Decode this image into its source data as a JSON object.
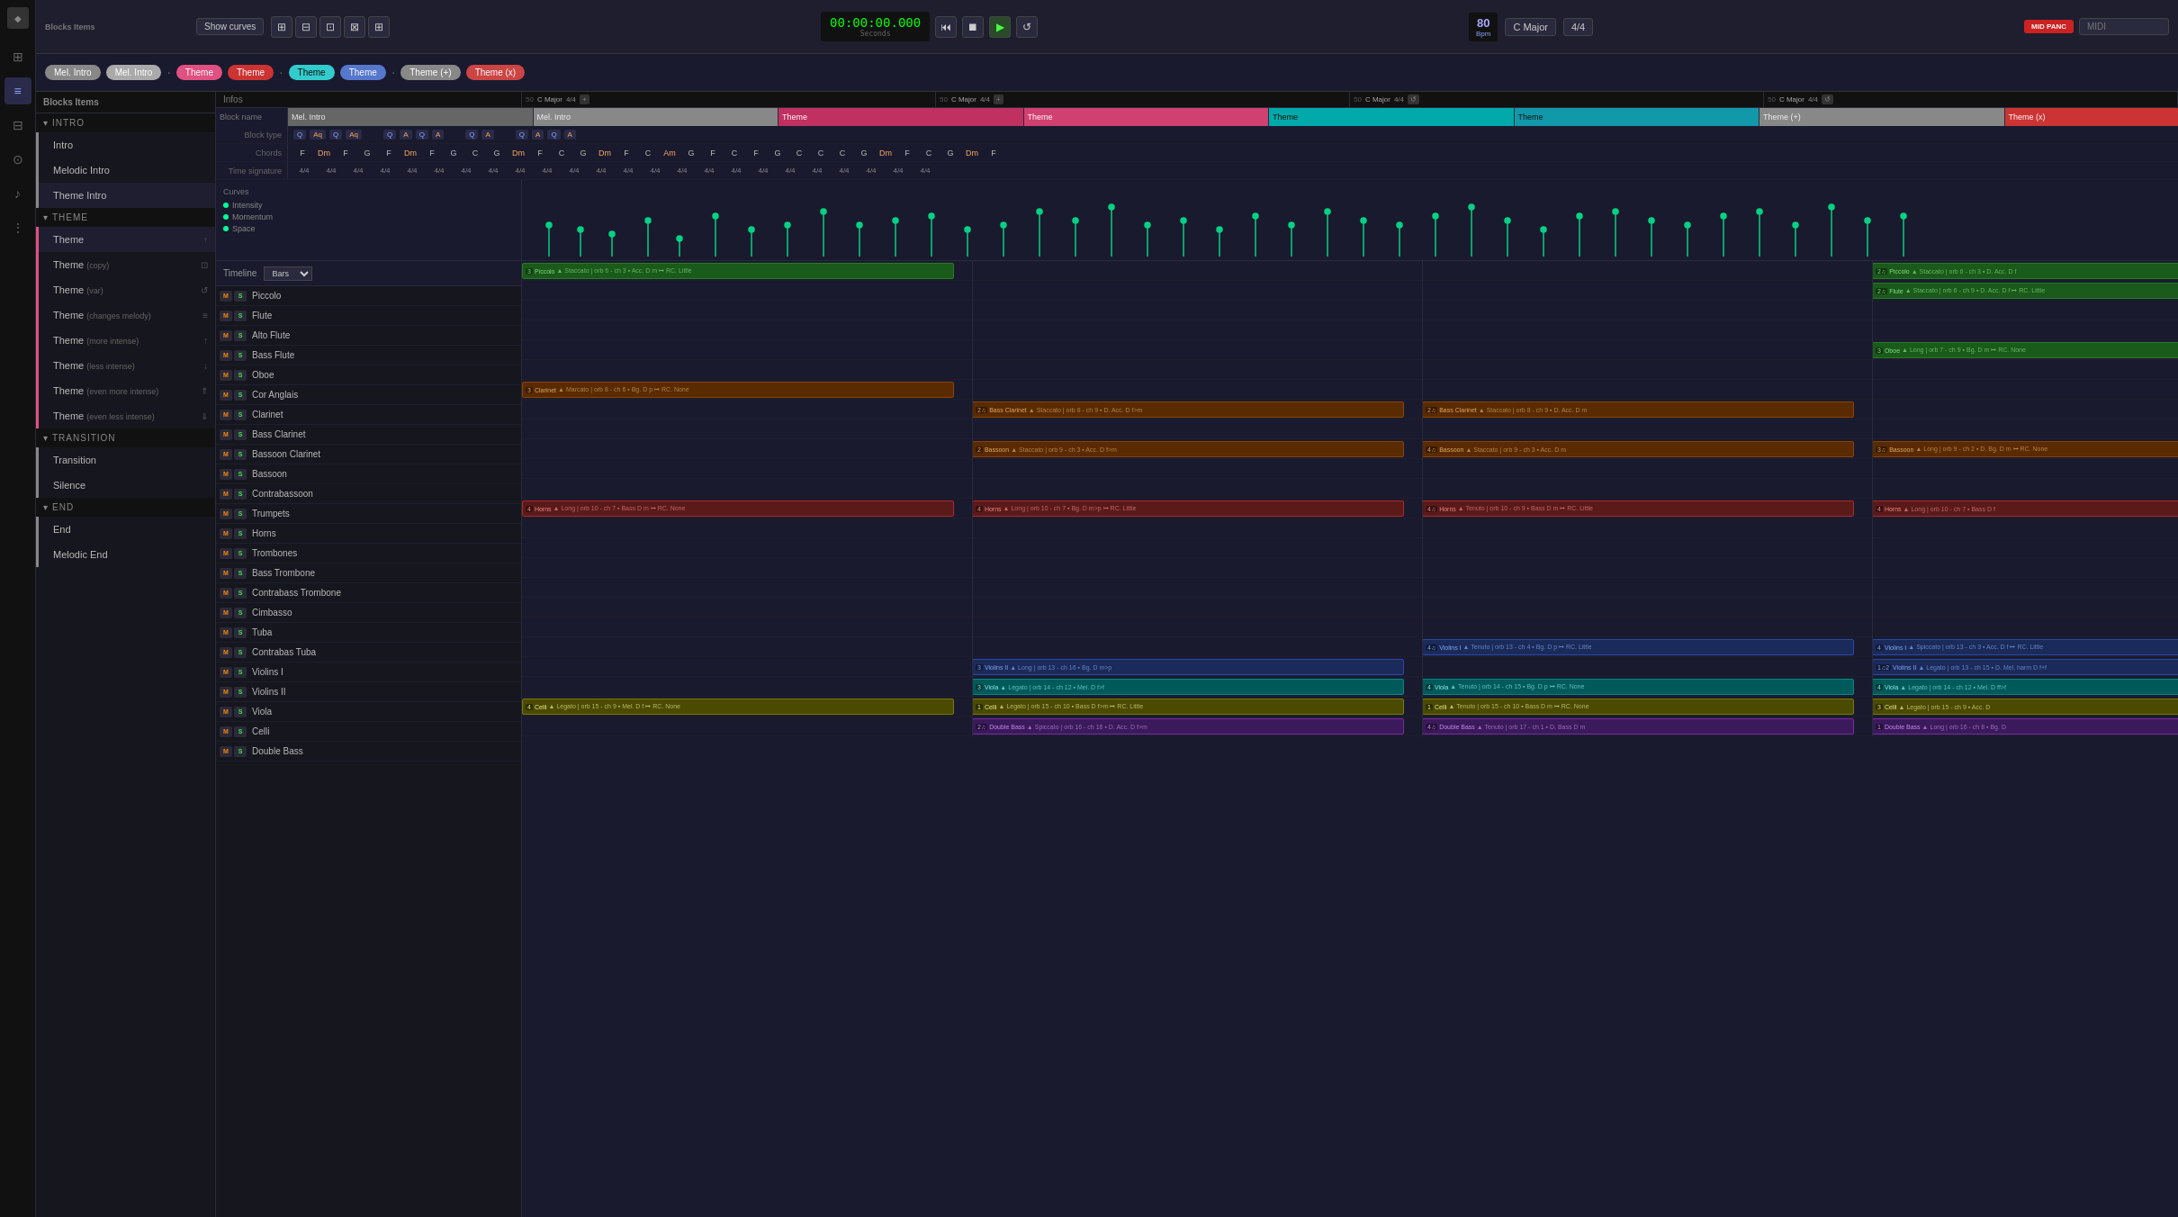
{
  "app": {
    "title": "Blocks Items"
  },
  "topToolbar": {
    "showCurves": "Show curves",
    "time": "00:00:00.000",
    "timeLabel": "Seconds",
    "bpm": "80",
    "bpmLabel": "Bpm",
    "key": "C Major",
    "timeSig": "4/4",
    "midi": "MID PANC",
    "midiLabel": "MIDI"
  },
  "blocksToolbar": [
    {
      "label": "Mel. Intro",
      "style": "mel-intro"
    },
    {
      "label": "Mel. Intro",
      "style": "mel-intro-active"
    },
    {
      "label": "Theme",
      "style": "theme-pink"
    },
    {
      "label": "Theme",
      "style": "theme-red"
    },
    {
      "label": "Theme",
      "style": "theme-cyan"
    },
    {
      "label": "Theme",
      "style": "theme-blue"
    },
    {
      "label": "Theme (+)",
      "style": "theme-plus"
    },
    {
      "label": "Theme (x)",
      "style": "theme-x"
    }
  ],
  "sidebarSections": [
    {
      "id": "intro",
      "label": "INTRO",
      "items": [
        {
          "name": "Intro",
          "barStyle": "gray"
        },
        {
          "name": "Melodic Intro",
          "barStyle": "gray"
        },
        {
          "name": "Theme Intro",
          "barStyle": "gray"
        }
      ]
    },
    {
      "id": "theme",
      "label": "THEME",
      "items": [
        {
          "name": "Theme",
          "barStyle": "pink"
        },
        {
          "name": "Theme",
          "sub": "(copy)",
          "barStyle": "pink",
          "icon": "copy"
        },
        {
          "name": "Theme",
          "sub": "(var)",
          "barStyle": "pink",
          "icon": "refresh"
        },
        {
          "name": "Theme",
          "sub": "(changes melody)",
          "barStyle": "pink",
          "icon": "eq"
        },
        {
          "name": "Theme",
          "sub": "(more intense)",
          "barStyle": "pink",
          "icon": "up"
        },
        {
          "name": "Theme",
          "sub": "(less intense)",
          "barStyle": "pink",
          "icon": "down"
        },
        {
          "name": "Theme",
          "sub": "(even more intense)",
          "barStyle": "pink",
          "icon": "upup"
        },
        {
          "name": "Theme",
          "sub": "(even less intense)",
          "barStyle": "pink",
          "icon": "downdown"
        }
      ]
    },
    {
      "id": "transition",
      "label": "TRANSITION",
      "items": [
        {
          "name": "Transition",
          "barStyle": "gray"
        },
        {
          "name": "Silence",
          "barStyle": "gray"
        }
      ]
    },
    {
      "id": "end",
      "label": "END",
      "items": [
        {
          "name": "End",
          "barStyle": "gray"
        },
        {
          "name": "Melodic End",
          "barStyle": "gray"
        }
      ]
    }
  ],
  "infosPanel": {
    "sections": [
      {
        "num": "50",
        "key": "C Major",
        "sig": "4/4"
      },
      {
        "num": "50",
        "key": "C Major",
        "sig": "4/4"
      },
      {
        "num": "50",
        "key": "C Major",
        "sig": "4/4"
      },
      {
        "num": "50",
        "key": "C Major",
        "sig": "4/4"
      }
    ],
    "blockNames": [
      "Mel. Intro",
      "Mel. Intro",
      "Theme",
      "Theme",
      "Theme",
      "Theme",
      "Theme (+)",
      "Theme (x)"
    ],
    "structureRow": {
      "label": "Block type",
      "items": [
        "Q",
        "Aq",
        "Q",
        "Aq",
        "Q",
        "A",
        "Q",
        "A",
        "Q",
        "A",
        "Q",
        "A"
      ]
    },
    "chordsRow": {
      "label": "Chords",
      "items": [
        "F",
        "Dm",
        "F",
        "G",
        "F",
        "Dm",
        "F",
        "G",
        "C",
        "G",
        "Dm",
        "F",
        "C",
        "G",
        "Dm",
        "F",
        "C",
        "Am",
        "G",
        "F",
        "C",
        "F",
        "G",
        "C",
        "C",
        "C",
        "G",
        "Dm",
        "F",
        "C",
        "G",
        "Dm",
        "F"
      ]
    },
    "timeSigRow": {
      "label": "Time signature",
      "value": "4/4"
    }
  },
  "curvesPanel": {
    "items": [
      "Intensity",
      "Momentum",
      "Space"
    ]
  },
  "timeline": {
    "label": "Timeline",
    "barsLabel": "Bars",
    "tracks": [
      {
        "name": "Piccolo",
        "m": true,
        "s": true
      },
      {
        "name": "Flute",
        "m": true,
        "s": true
      },
      {
        "name": "Alto Flute",
        "m": true,
        "s": true
      },
      {
        "name": "Bass Flute",
        "m": true,
        "s": true
      },
      {
        "name": "Oboe",
        "m": true,
        "s": true
      },
      {
        "name": "Cor Anglais",
        "m": true,
        "s": true
      },
      {
        "name": "Clarinet",
        "m": true,
        "s": true
      },
      {
        "name": "Bass Clarinet",
        "m": true,
        "s": true
      },
      {
        "name": "Bassoon Clarinet",
        "m": true,
        "s": true
      },
      {
        "name": "Bassoon",
        "m": true,
        "s": true
      },
      {
        "name": "Contrabassoon",
        "m": true,
        "s": true
      },
      {
        "name": "Trumpets",
        "m": true,
        "s": true
      },
      {
        "name": "Horns",
        "m": true,
        "s": true
      },
      {
        "name": "Trombones",
        "m": true,
        "s": true
      },
      {
        "name": "Bass Trombone",
        "m": true,
        "s": true
      },
      {
        "name": "Contrabass Trombone",
        "m": true,
        "s": true
      },
      {
        "name": "Cimbasso",
        "m": true,
        "s": true
      },
      {
        "name": "Tuba",
        "m": true,
        "s": true
      },
      {
        "name": "Contrabas Tuba",
        "m": true,
        "s": true
      },
      {
        "name": "Violins I",
        "m": true,
        "s": true
      },
      {
        "name": "Violins II",
        "m": true,
        "s": true
      },
      {
        "name": "Viola",
        "m": true,
        "s": true
      },
      {
        "name": "Celli",
        "m": true,
        "s": true
      },
      {
        "name": "Double Bass",
        "m": true,
        "s": true
      }
    ]
  },
  "colors": {
    "bg": "#1a1a2e",
    "sidebar": "#16161e",
    "pink": "#e05080",
    "cyan": "#00cccc",
    "green": "#2a6a2a",
    "orange": "#8a4400",
    "red": "#8a1a1a"
  }
}
